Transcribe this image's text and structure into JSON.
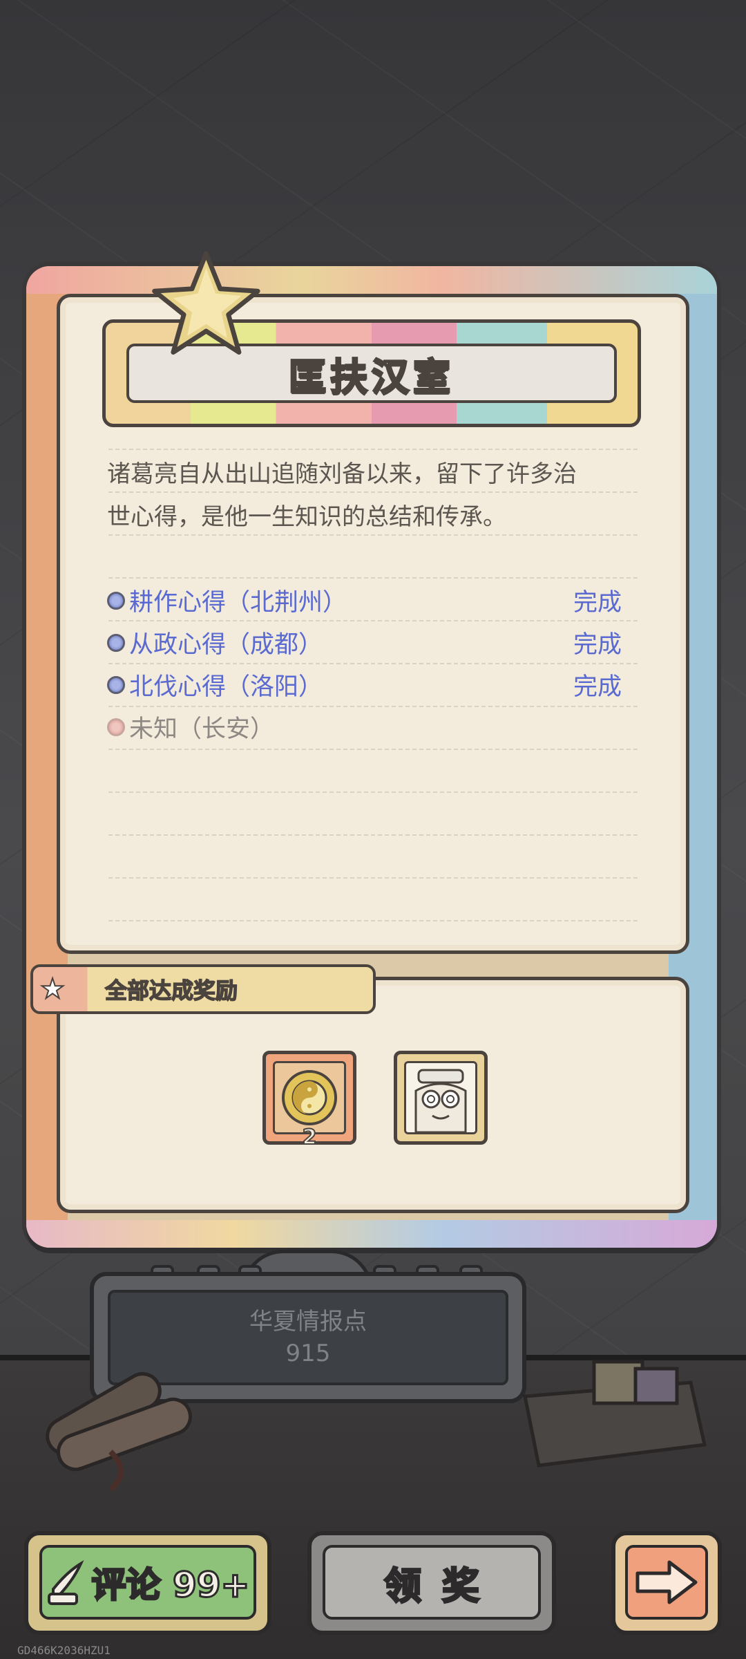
{
  "title": "匡扶汉室",
  "description_lines": [
    "诸葛亮自从出山追随刘备以来，留下了许多治",
    "世心得，是他一生知识的总结和传承。"
  ],
  "tasks": [
    {
      "label": "耕作心得（北荆州）",
      "status": "完成"
    },
    {
      "label": "从政心得（成都）",
      "status": "完成"
    },
    {
      "label": "北伐心得（洛阳）",
      "status": "完成"
    },
    {
      "label": "未知（长安）",
      "status": ""
    }
  ],
  "reward_section": {
    "title": "全部达成奖励",
    "items": [
      {
        "icon": "taiji-coin-icon",
        "count": "2"
      },
      {
        "icon": "character-avatar-icon",
        "count": ""
      }
    ]
  },
  "info": {
    "label": "华夏情报点",
    "value": "915"
  },
  "buttons": {
    "comment": "评论 99+",
    "claim": "领奖",
    "next_icon": "right-arrow-icon"
  },
  "build_id": "GD466K2036HZU1",
  "colors": {
    "completed": "#5a6ad0",
    "locked": "#8d8884"
  }
}
